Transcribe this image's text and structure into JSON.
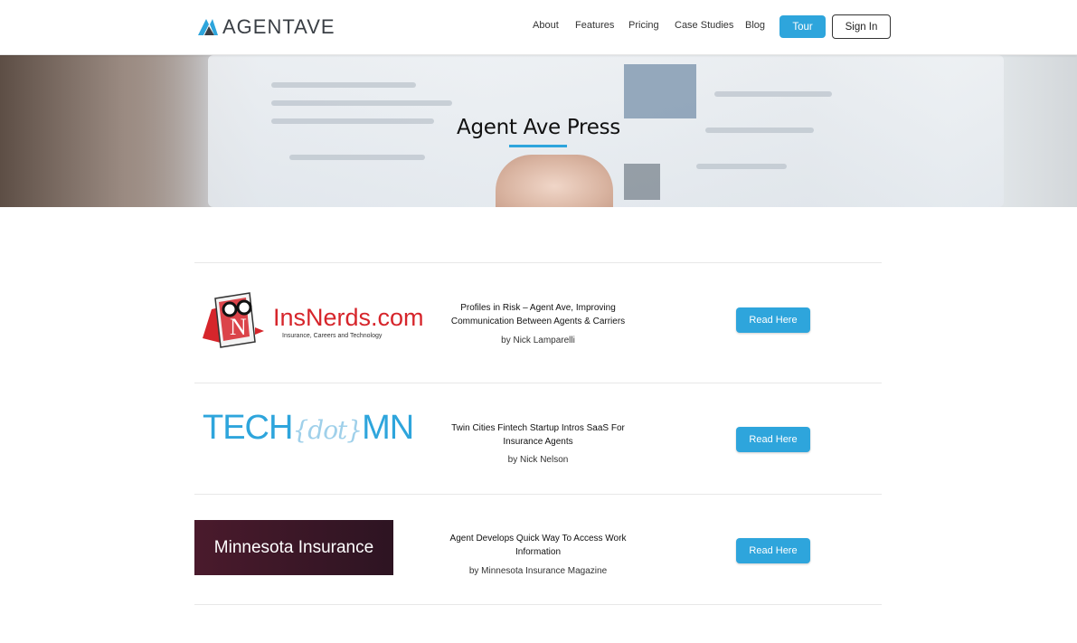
{
  "header": {
    "logo_text": "AGENTAVE",
    "nav": [
      "About",
      "Features",
      "Pricing",
      "Case Studies",
      "Blog"
    ],
    "tour_label": "Tour",
    "signin_label": "Sign In"
  },
  "hero": {
    "title": "Agent Ave Press"
  },
  "press": [
    {
      "logo_text": "InsNerds.com",
      "logo_sub": "Insurance, Careers and Technology",
      "title": "Profiles in Risk – Agent Ave, Improving Communication Between Agents & Carriers",
      "author": "by Nick Lamparelli",
      "button": "Read Here"
    },
    {
      "logo_text_pre": "TECH",
      "logo_text_mid": "{dot}",
      "logo_text_post": "MN",
      "title": "Twin Cities Fintech Startup Intros SaaS For Insurance Agents",
      "author": "by Nick Nelson",
      "button": "Read Here"
    },
    {
      "logo_text": "Minnesota Insurance",
      "title": "Agent Develops Quick Way To Access Work Information",
      "author": "by Minnesota Insurance Magazine",
      "button": "Read Here"
    }
  ],
  "colors": {
    "accent": "#2ea5dc",
    "insnerds_red": "#d6252b",
    "mn_banner": "#3d1826"
  }
}
